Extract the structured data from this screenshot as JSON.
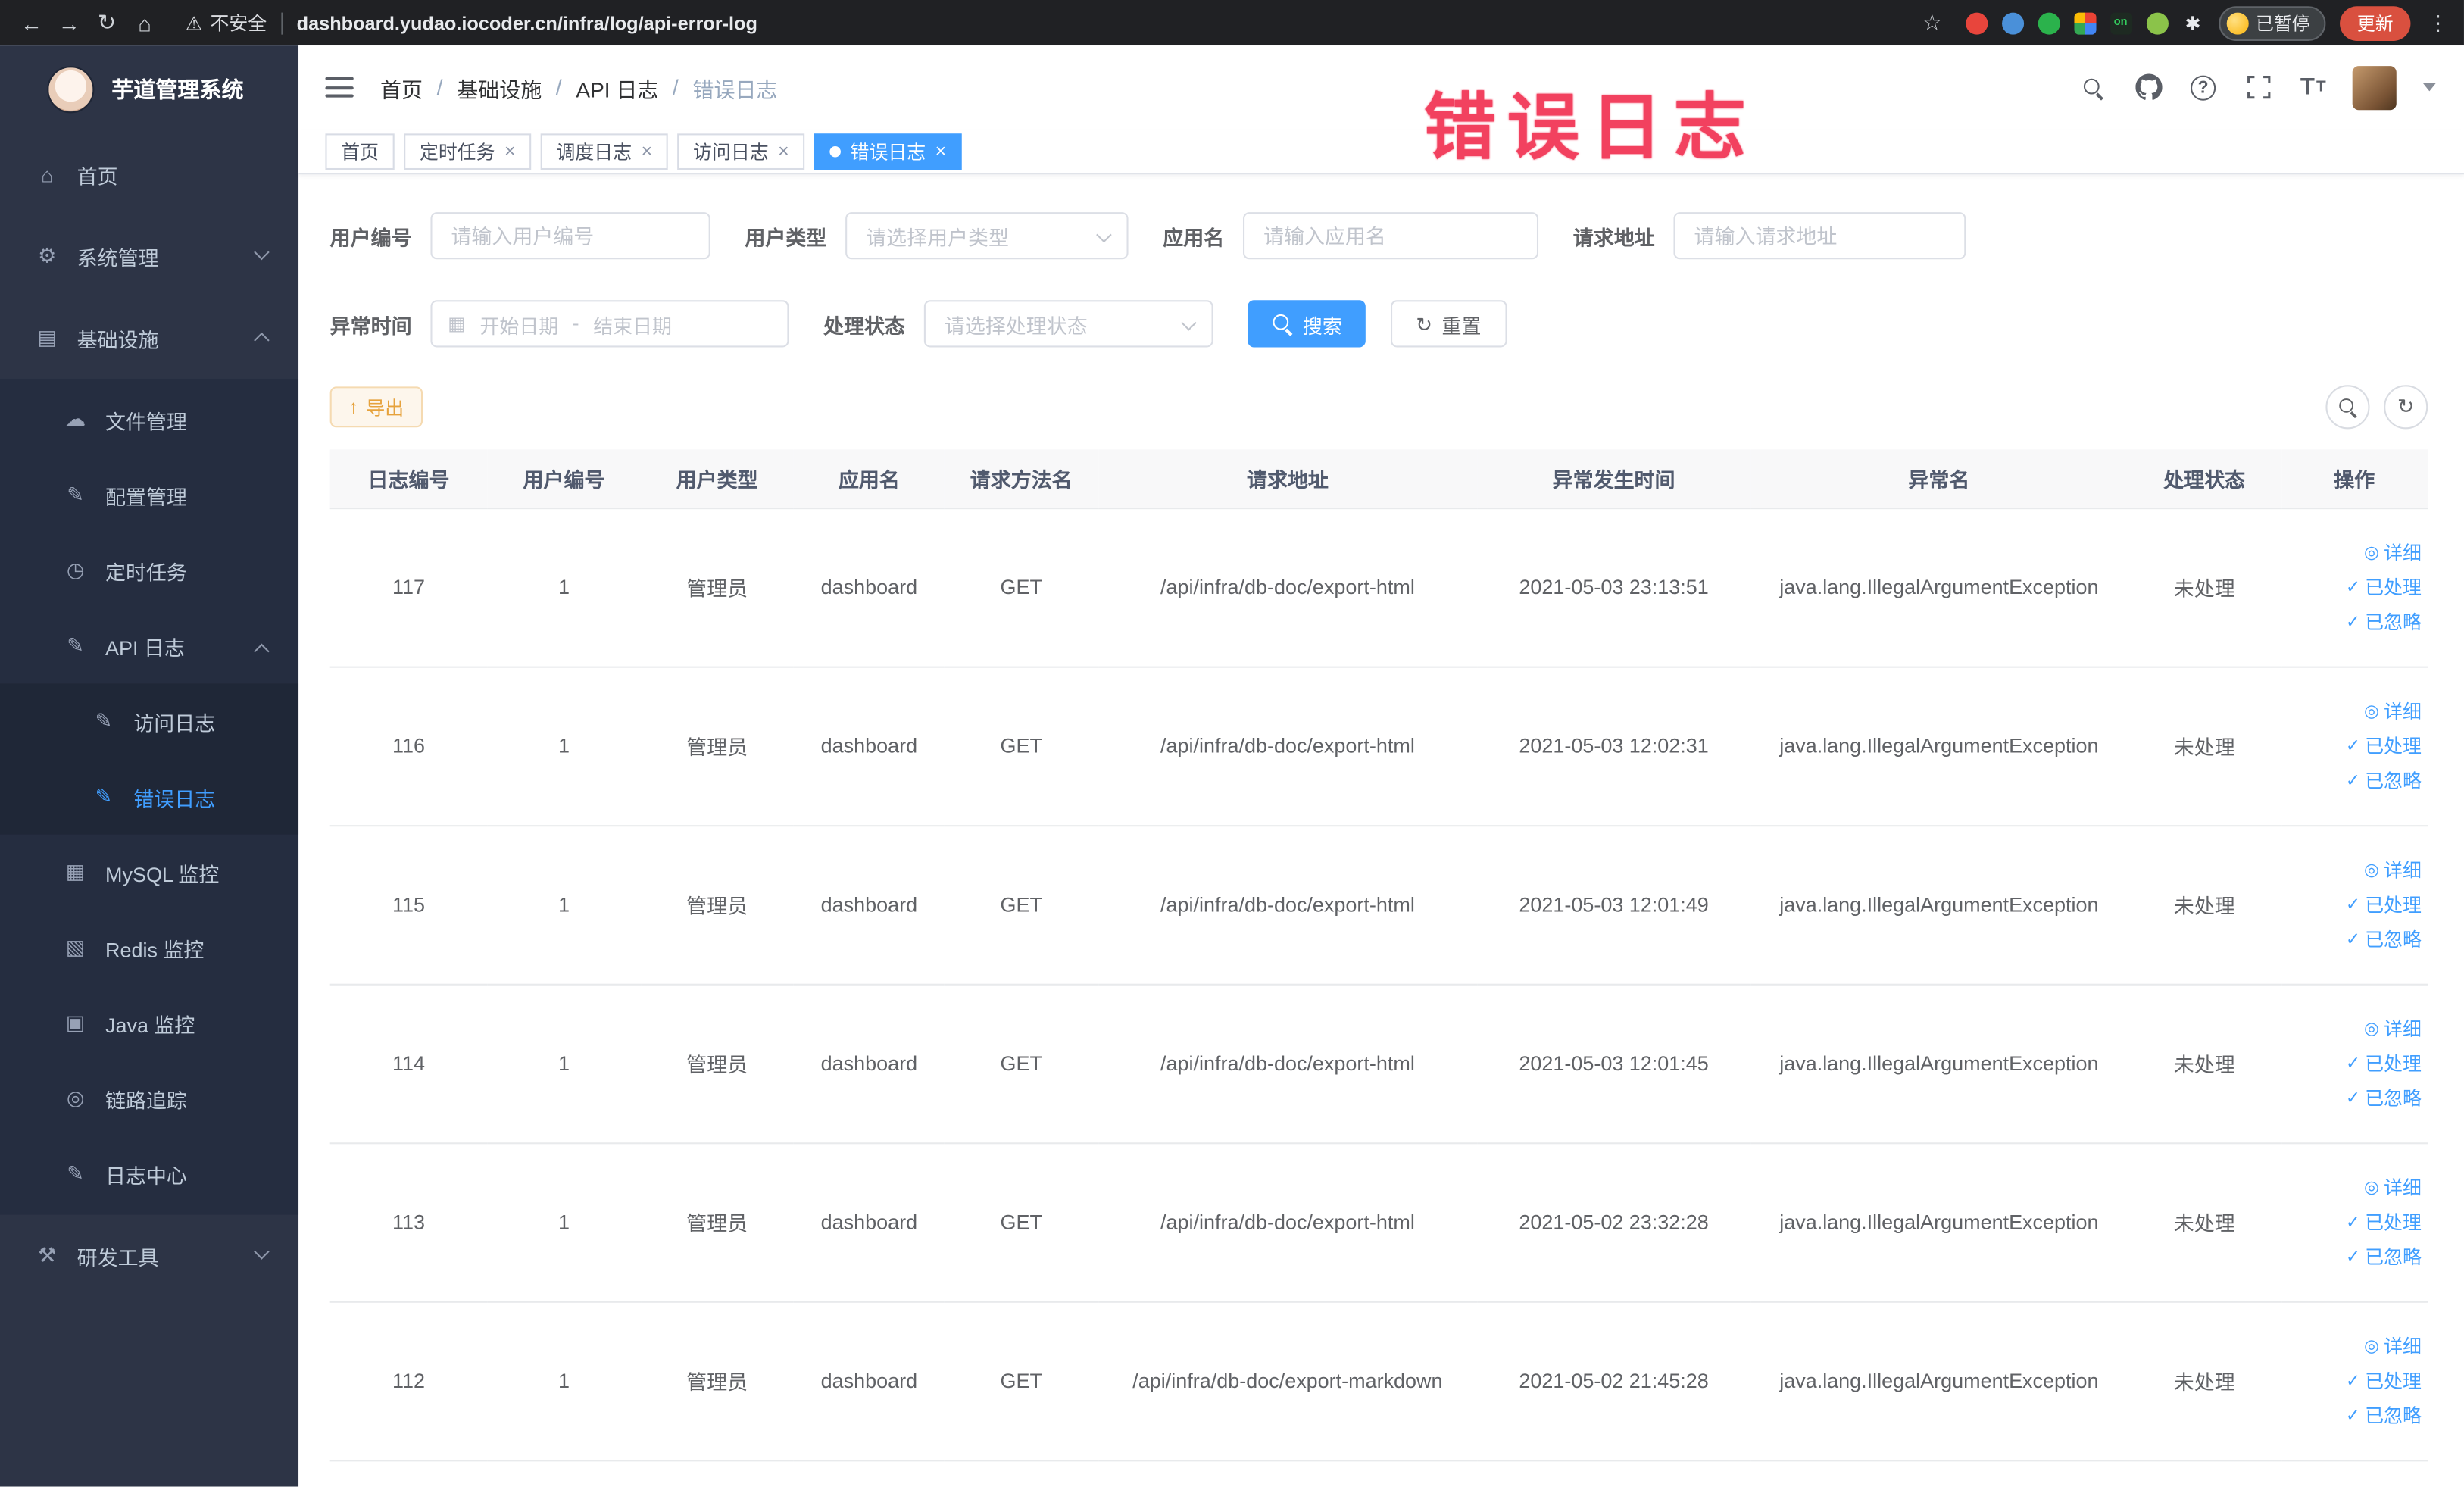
{
  "colors": {
    "primary": "#409eff",
    "sidebar_bg": "#2d3446",
    "submenu_bg": "#252d40",
    "submenu3_bg": "#1f2737",
    "annotation": "#f2415f",
    "warning_button": "#e6a23c",
    "update_button": "#d9503f",
    "chrome_bg": "#202124"
  },
  "icons": {
    "back_arrow": "←",
    "forward_arrow": "→",
    "reload": "↻",
    "home": "⌂",
    "warning": "⚠",
    "star": "☆",
    "overflow_menu": "⋮",
    "paw": "✱",
    "menu_home": "⌂",
    "menu_system": "⚙",
    "menu_infra": "▤",
    "menu_file": "☁",
    "menu_config": "✎",
    "menu_job": "◷",
    "menu_apilog": "✎",
    "menu_accesslog": "✎",
    "menu_errorlog": "✎",
    "menu_mysql": "▦",
    "menu_redis": "▧",
    "menu_java": "▣",
    "menu_trace": "◎",
    "menu_logcenter": "✎",
    "menu_devtools": "⚒",
    "question": "?",
    "font_size": "T",
    "refresh": "↻",
    "calendar": "▦",
    "export": "↑",
    "check": "✓",
    "detail": "◎"
  },
  "browser": {
    "security_label": "不安全",
    "url": "dashboard.yudao.iocoder.cn/infra/log/api-error-log",
    "on_badge": "on",
    "paused_badge": "已暂停",
    "update_button": "更新"
  },
  "sidebar": {
    "title": "芋道管理系统",
    "home": "首页",
    "system": "系统管理",
    "infra": "基础设施",
    "file": "文件管理",
    "config": "配置管理",
    "job": "定时任务",
    "apilog": "API 日志",
    "accesslog": "访问日志",
    "errorlog": "错误日志",
    "mysql": "MySQL 监控",
    "redis": "Redis 监控",
    "java": "Java 监控",
    "trace": "链路追踪",
    "logcenter": "日志中心",
    "devtools": "研发工具"
  },
  "header": {
    "breadcrumb": [
      "首页",
      "基础设施",
      "API 日志",
      "错误日志"
    ],
    "breadcrumb_separator": "/"
  },
  "annotation": "错误日志",
  "tabs": {
    "close_glyph": "×",
    "items": [
      {
        "label": "首页"
      },
      {
        "label": "定时任务"
      },
      {
        "label": "调度日志"
      },
      {
        "label": "访问日志"
      },
      {
        "label": "错误日志"
      }
    ]
  },
  "filters": {
    "user_id_label": "用户编号",
    "user_id_placeholder": "请输入用户编号",
    "user_type_label": "用户类型",
    "user_type_placeholder": "请选择用户类型",
    "app_name_label": "应用名",
    "app_name_placeholder": "请输入应用名",
    "request_url_label": "请求地址",
    "request_url_placeholder": "请输入请求地址",
    "time_label": "异常时间",
    "time_start_placeholder": "开始日期",
    "time_separator": "-",
    "time_end_placeholder": "结束日期",
    "status_label": "处理状态",
    "status_placeholder": "请选择处理状态",
    "search_button": "搜索",
    "reset_button": "重置"
  },
  "toolbar": {
    "export_button": "导出"
  },
  "table": {
    "columns": [
      "日志编号",
      "用户编号",
      "用户类型",
      "应用名",
      "请求方法名",
      "请求地址",
      "异常发生时间",
      "异常名",
      "处理状态",
      "操作"
    ],
    "actions": {
      "detail": "详细",
      "processed": "已处理",
      "ignored": "已忽略"
    },
    "rows": [
      {
        "id": "117",
        "user": "1",
        "type": "管理员",
        "app": "dashboard",
        "method": "GET",
        "url": "/api/infra/db-doc/export-html",
        "time": "2021-05-03 23:13:51",
        "exception": "java.lang.IllegalArgumentException",
        "status": "未处理"
      },
      {
        "id": "116",
        "user": "1",
        "type": "管理员",
        "app": "dashboard",
        "method": "GET",
        "url": "/api/infra/db-doc/export-html",
        "time": "2021-05-03 12:02:31",
        "exception": "java.lang.IllegalArgumentException",
        "status": "未处理"
      },
      {
        "id": "115",
        "user": "1",
        "type": "管理员",
        "app": "dashboard",
        "method": "GET",
        "url": "/api/infra/db-doc/export-html",
        "time": "2021-05-03 12:01:49",
        "exception": "java.lang.IllegalArgumentException",
        "status": "未处理"
      },
      {
        "id": "114",
        "user": "1",
        "type": "管理员",
        "app": "dashboard",
        "method": "GET",
        "url": "/api/infra/db-doc/export-html",
        "time": "2021-05-03 12:01:45",
        "exception": "java.lang.IllegalArgumentException",
        "status": "未处理"
      },
      {
        "id": "113",
        "user": "1",
        "type": "管理员",
        "app": "dashboard",
        "method": "GET",
        "url": "/api/infra/db-doc/export-html",
        "time": "2021-05-02 23:32:28",
        "exception": "java.lang.IllegalArgumentException",
        "status": "未处理"
      },
      {
        "id": "112",
        "user": "1",
        "type": "管理员",
        "app": "dashboard",
        "method": "GET",
        "url": "/api/infra/db-doc/export-markdown",
        "time": "2021-05-02 21:45:28",
        "exception": "java.lang.IllegalArgumentException",
        "status": "未处理"
      }
    ]
  }
}
